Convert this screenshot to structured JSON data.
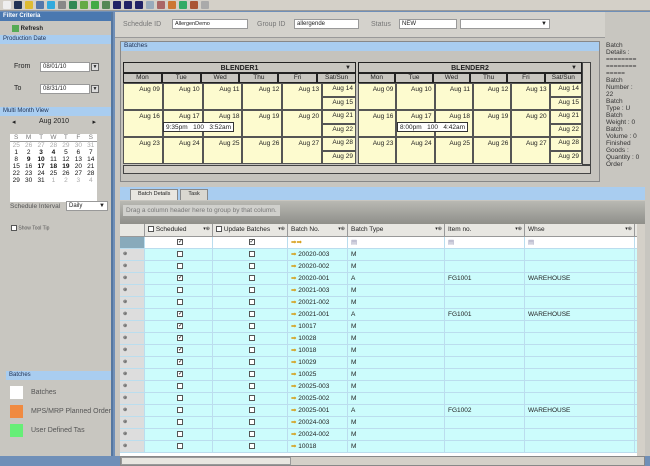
{
  "toolbar": {
    "icons": [
      "new-icon",
      "save-icon",
      "cube-icon",
      "search-icon",
      "db-icon",
      "wrench-icon",
      "chart-icon",
      "export-icon",
      "import-icon",
      "print-icon",
      "calendar-31-icon",
      "calendar-7-icon",
      "calendar-1-icon",
      "list-icon",
      "grid-icon",
      "puzzle-icon",
      "group-icon",
      "network-icon",
      "doc-icon"
    ]
  },
  "left": {
    "title": "Filter Criteria",
    "refresh": "Refresh",
    "production_date": "Production Date",
    "from_label": "From",
    "from_value": "08/01/10",
    "to_label": "To",
    "to_value": "08/31/10",
    "multi_month": "Multi Month View",
    "month": "Aug 2010",
    "weekdays": [
      "S",
      "M",
      "T",
      "W",
      "T",
      "F",
      "S"
    ],
    "weeks": [
      [
        "25",
        "26",
        "27",
        "28",
        "29",
        "30",
        "31"
      ],
      [
        "1",
        "2",
        "3",
        "4",
        "5",
        "6",
        "7"
      ],
      [
        "8",
        "9",
        "10",
        "11",
        "12",
        "13",
        "14"
      ],
      [
        "15",
        "16",
        "17",
        "18",
        "19",
        "20",
        "21"
      ],
      [
        "22",
        "23",
        "24",
        "25",
        "26",
        "27",
        "28"
      ],
      [
        "29",
        "30",
        "31",
        "1",
        "2",
        "3",
        "4"
      ]
    ],
    "interval_label": "Schedule Interval",
    "interval_value": "Daily",
    "tooltip_label": "Show Tool Tip",
    "legend_title": "Batches",
    "legend": [
      {
        "label": "Batches",
        "color": "#ffffff"
      },
      {
        "label": "MPS/MRP  Planned Order",
        "color": "#f08a40"
      },
      {
        "label": "User Defined Tas",
        "color": "#66ee77"
      }
    ]
  },
  "header": {
    "schedule_label": "Schedule ID",
    "schedule_value": "AllergenDemo",
    "group_label": "Group ID",
    "group_value": "allergende",
    "status_label": "Status",
    "status_value": "NEW"
  },
  "calendar": {
    "title": "Batches",
    "days": [
      "Mon",
      "Tue",
      "Wed",
      "Thu",
      "Fri",
      "Sat/Sun"
    ],
    "weeks": [
      [
        "Aug 09",
        "Aug 10",
        "Aug 11",
        "Aug 12",
        "Aug 13",
        "Aug 14",
        "Aug 15"
      ],
      [
        "Aug 16",
        "Aug 17",
        "Aug 18",
        "Aug 19",
        "Aug 20",
        "Aug 21",
        "Aug 22"
      ],
      [
        "Aug 23",
        "Aug 24",
        "Aug 25",
        "Aug 26",
        "Aug 27",
        "Aug 28",
        "Aug 29"
      ]
    ],
    "blenders": [
      {
        "name": "BLENDER1",
        "event": "9:35pm   100   3:52am"
      },
      {
        "name": "BLENDER2",
        "event": "8:00pm   100   4:42am"
      }
    ]
  },
  "detail": "Batch\nDetails :\n========\n========\n=====\nBatch\nNumber :\n22\nBatch\nType : U\nBatch\nWeight : 0\nBatch\nVolume : 0\nFinished\nGoods :\nQuantity : 0\nOrder",
  "tabs": [
    "Batch Details",
    "Task"
  ],
  "grid": {
    "group_hint": "Drag a column header here to group by that column.",
    "columns": [
      "Scheduled",
      "Update Batches",
      "Batch No.",
      "Batch Type",
      "Item no.",
      "Whse"
    ],
    "rows": [
      {
        "s": false,
        "no": "20020-003",
        "type": "M",
        "item": "",
        "whse": ""
      },
      {
        "s": false,
        "no": "20020-002",
        "type": "M",
        "item": "",
        "whse": ""
      },
      {
        "s": true,
        "no": "20020-001",
        "type": "A",
        "item": "FG1001",
        "whse": "WAREHOUSE"
      },
      {
        "s": false,
        "no": "20021-003",
        "type": "M",
        "item": "",
        "whse": ""
      },
      {
        "s": false,
        "no": "20021-002",
        "type": "M",
        "item": "",
        "whse": ""
      },
      {
        "s": true,
        "no": "20021-001",
        "type": "A",
        "item": "FG1001",
        "whse": "WAREHOUSE"
      },
      {
        "s": true,
        "no": "10017",
        "type": "M",
        "item": "",
        "whse": ""
      },
      {
        "s": true,
        "no": "10028",
        "type": "M",
        "item": "",
        "whse": ""
      },
      {
        "s": true,
        "no": "10018",
        "type": "M",
        "item": "",
        "whse": ""
      },
      {
        "s": true,
        "no": "10029",
        "type": "M",
        "item": "",
        "whse": ""
      },
      {
        "s": true,
        "no": "10025",
        "type": "M",
        "item": "",
        "whse": ""
      },
      {
        "s": false,
        "no": "20025-003",
        "type": "M",
        "item": "",
        "whse": ""
      },
      {
        "s": false,
        "no": "20025-002",
        "type": "M",
        "item": "",
        "whse": ""
      },
      {
        "s": false,
        "no": "20025-001",
        "type": "A",
        "item": "FG1002",
        "whse": "WAREHOUSE"
      },
      {
        "s": false,
        "no": "20024-003",
        "type": "M",
        "item": "",
        "whse": ""
      },
      {
        "s": false,
        "no": "20024-002",
        "type": "M",
        "item": "",
        "whse": ""
      },
      {
        "s": false,
        "no": "10018",
        "type": "M",
        "item": "",
        "whse": ""
      }
    ]
  }
}
